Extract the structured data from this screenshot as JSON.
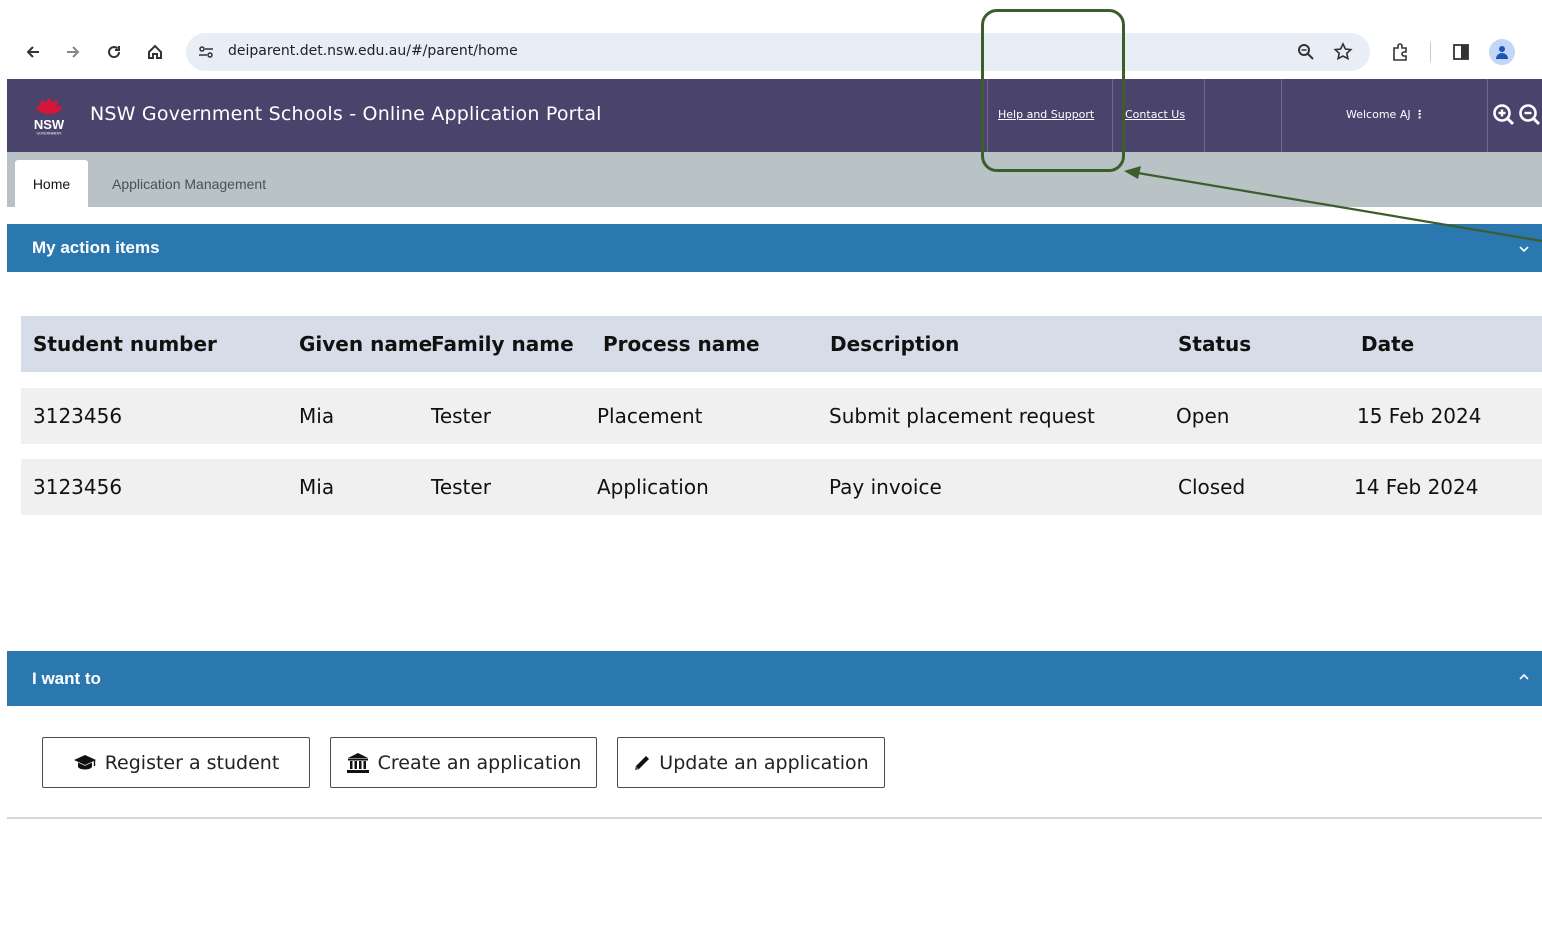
{
  "browser": {
    "url": "deiparent.det.nsw.edu.au/#/parent/home",
    "back_icon": "arrow-left-icon",
    "forward_icon": "arrow-right-icon",
    "reload_icon": "reload-icon",
    "home_icon": "home-icon"
  },
  "header": {
    "logo_text": "NSW",
    "logo_subtext": "GOVERNMENT",
    "title": "NSW Government Schools - Online Application Portal",
    "links": {
      "help": "Help and Support",
      "contact": "Contact Us"
    },
    "welcome": "Welcome AJ",
    "background": "#4a446d"
  },
  "tabs": [
    {
      "label": "Home",
      "active": true
    },
    {
      "label": "Application Management",
      "active": false
    }
  ],
  "action_items": {
    "title": "My action items",
    "columns": [
      "Student number",
      "Given name",
      "Family name",
      "Process name",
      "Description",
      "Status",
      "Date"
    ],
    "rows": [
      [
        "3123456",
        "Mia",
        "Tester",
        "Placement",
        "Submit placement request",
        "Open",
        "15 Feb 2024"
      ],
      [
        "3123456",
        "Mia",
        "Tester",
        "Application",
        "Pay invoice",
        "Closed",
        "14 Feb 2024"
      ]
    ]
  },
  "i_want_to": {
    "title": "I want to",
    "buttons": {
      "register": "Register a student",
      "create": "Create an application",
      "update": "Update an application"
    }
  },
  "colors": {
    "panel_header": "#2b78b1",
    "table_header": "#d6dde8",
    "annotation": "#3b5e2b"
  }
}
